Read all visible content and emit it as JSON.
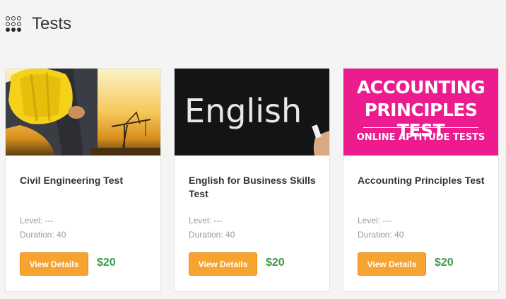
{
  "header": {
    "title": "Tests",
    "icon": "grid-icon"
  },
  "cards": [
    {
      "title": "Civil Engineering Test",
      "level": "Level: ---",
      "duration": "Duration: 40",
      "button": "View Details",
      "price": "$20",
      "image_text": ""
    },
    {
      "title": "English for Business Skills Test",
      "level": "Level: ---",
      "duration": "Duration: 40",
      "button": "View Details",
      "price": "$20",
      "image_text": "English"
    },
    {
      "title": "Accounting Principles Test",
      "level": "Level: ---",
      "duration": "Duration: 40",
      "button": "View Details",
      "price": "$20",
      "image_text_line1": "ACCOUNTING",
      "image_text_line2": "PRINCIPLES TEST",
      "image_text_line3": "ONLINE APTITUDE TESTS"
    }
  ],
  "colors": {
    "button": "#f7a330",
    "price": "#3a9a4a",
    "accounting_bg": "#ec1c8e"
  }
}
